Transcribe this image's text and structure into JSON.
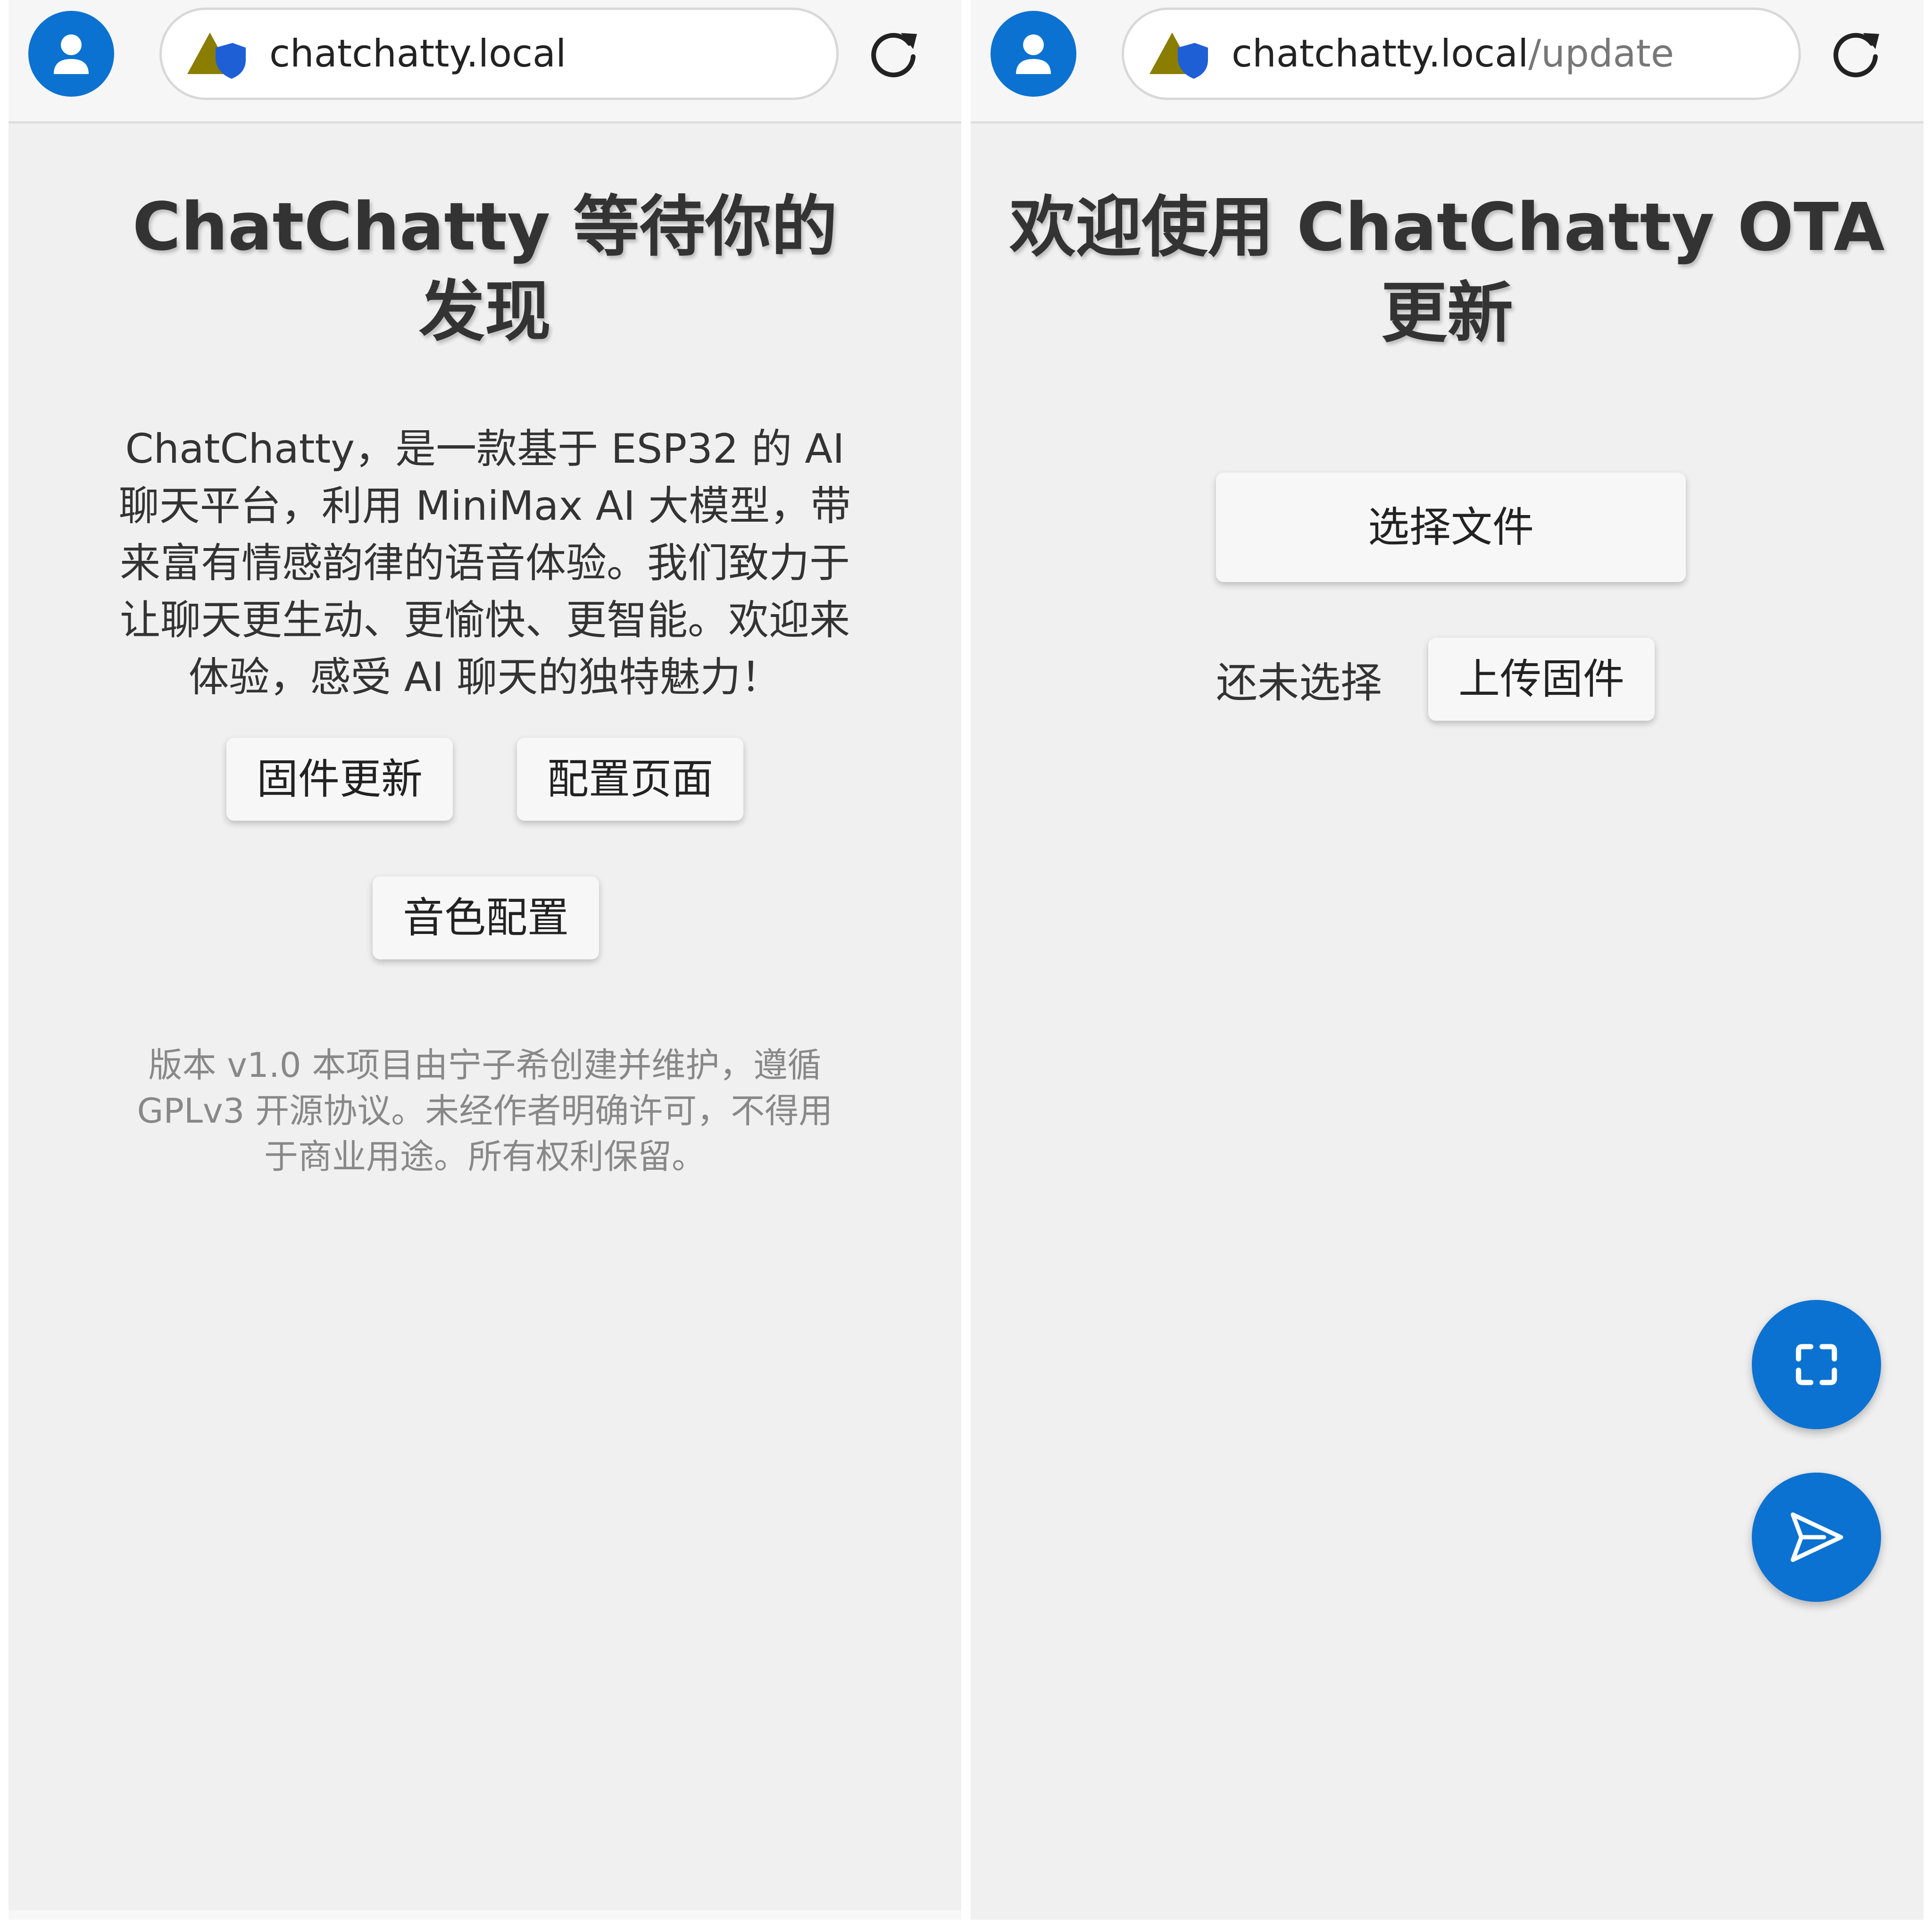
{
  "colors": {
    "accent": "#0b72d1",
    "page_bg": "#f0f0f0",
    "topbar_bg": "#f6f6f6",
    "text": "#333333",
    "muted_text": "#888888"
  },
  "left": {
    "browser": {
      "url_host": "chatchatty.local",
      "url_path": ""
    },
    "title": "ChatChatty 等待你的发现",
    "description": "ChatChatty，是一款基于 ESP32 的 AI 聊天平台，利用 MiniMax AI 大模型，带来富有情感韵律的语音体验。我们致力于让聊天更生动、更愉快、更智能。欢迎来体验，感受 AI 聊天的独特魅力！",
    "buttons": {
      "firmware_update": "固件更新",
      "config_page": "配置页面",
      "voice_config": "音色配置"
    },
    "footer": "版本 v1.0 本项目由宁子希创建并维护，遵循 GPLv3 开源协议。未经作者明确许可，不得用于商业用途。所有权利保留。"
  },
  "right": {
    "browser": {
      "url_host": "chatchatty.local",
      "url_path": "/update"
    },
    "title": "欢迎使用 ChatChatty OTA 更新",
    "choose_file_label": "选择文件",
    "file_status": "还未选择",
    "upload_label": "上传固件",
    "fab_icons": [
      "scan-icon",
      "send-icon"
    ]
  }
}
